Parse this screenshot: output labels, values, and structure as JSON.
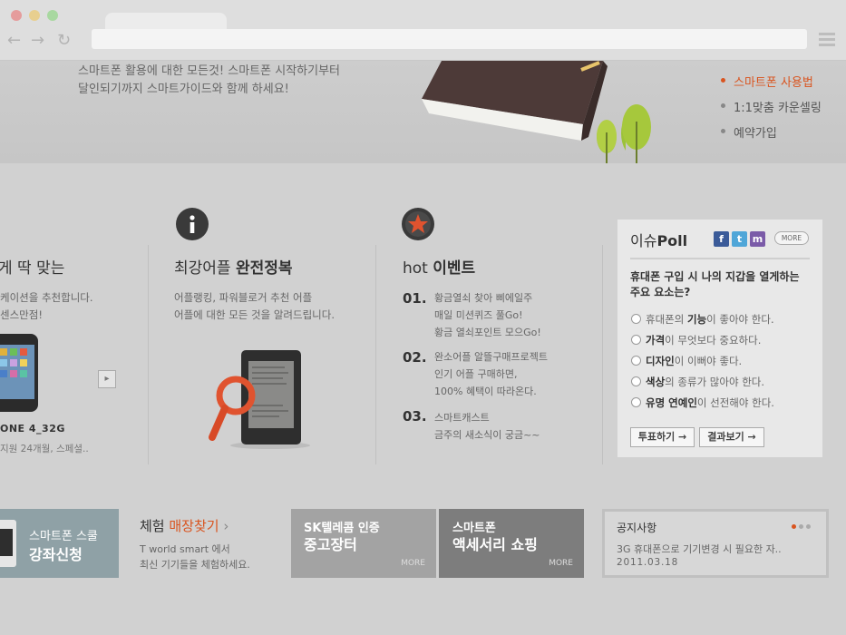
{
  "browser": {
    "back_glyph": "←",
    "forward_glyph": "→",
    "reload_glyph": "↻"
  },
  "hero": {
    "line1": "스마트폰 활용에 대한 모든것! 스마트폰 시작하기부터",
    "line2": "달인되기까지 스마트가이드와 함께 하세요!",
    "nav": [
      "스마트폰 사용법",
      "1:1맞춤 카운셀링",
      "예약가입"
    ]
  },
  "col1": {
    "title_partial": "게 딱 맞는",
    "desc1": "케이션을 추천합니다.",
    "desc2": "센스만점!",
    "product": "ONE 4_32G",
    "product_sub": "지원 24개월, 스페셜..",
    "next_glyph": "▸"
  },
  "col2": {
    "icon": "info-icon",
    "title_a": "최강어플 ",
    "title_b": "완전정복",
    "desc1": "어플랭킹, 파워블로거 추천 어플",
    "desc2": "어플에 대한 모든 것을 알려드립니다."
  },
  "col3": {
    "icon": "star-icon",
    "title_a": "hot ",
    "title_b": "이벤트",
    "events": [
      {
        "num": "01.",
        "lines": [
          "황금열쇠 찾아 삐에일주",
          "매일 미션퀴즈 풀Go!",
          "황금 열쇠포인트 모으Go!"
        ]
      },
      {
        "num": "02.",
        "lines": [
          "완소어플 알뜰구매프로젝트",
          "인기 어플 구매하면,",
          "100% 혜택이 따라온다."
        ]
      },
      {
        "num": "03.",
        "lines": [
          "스마트캐스트",
          "금주의 새소식이 궁금~~"
        ]
      }
    ]
  },
  "poll": {
    "title_a": "이슈",
    "title_b": "Poll",
    "sns": [
      "f",
      "t",
      "m"
    ],
    "more_label": "MORE",
    "question": "휴대폰 구입 시 나의 지갑을 열게하는 주요 요소는?",
    "options": [
      {
        "pre": "휴대폰의 ",
        "key": "기능",
        "post": "이 좋아야 한다."
      },
      {
        "pre": "",
        "key": "가격",
        "post": "이 무엇보다 중요하다."
      },
      {
        "pre": "",
        "key": "디자인",
        "post": "이 이뻐야 좋다."
      },
      {
        "pre": "",
        "key": "색상",
        "post": "의 종류가 많아야 한다."
      },
      {
        "pre": "",
        "key": "유명 연예인",
        "post": "이 선전해야 한다."
      }
    ],
    "vote_label": "투표하기 →",
    "result_label": "결과보기 →"
  },
  "bottom": {
    "school_t1": "스마트폰 스쿨",
    "school_t2": "강좌신청",
    "store_a": "체험 ",
    "store_b": "매장찾기",
    "store_arrow": "›",
    "store_d1": "T world smart 에서",
    "store_d2": "최신 기기들을 체험하세요.",
    "used_t1": "SK텔레콤 인증",
    "used_t2": "중고장터",
    "used_more": "MORE",
    "acc_t1": "스마트폰",
    "acc_t2": "액세서리 쇼핑",
    "acc_more": "MORE"
  },
  "notice": {
    "title": "공지사항",
    "text": "3G 휴대폰으로 기기변경 시 필요한 자..",
    "date": "2011.03.18"
  },
  "colors": {
    "accent": "#d9541f",
    "school_bg": "#8fa1a6",
    "used_bg": "#a3a3a3",
    "acc_bg": "#7d7d7d"
  }
}
